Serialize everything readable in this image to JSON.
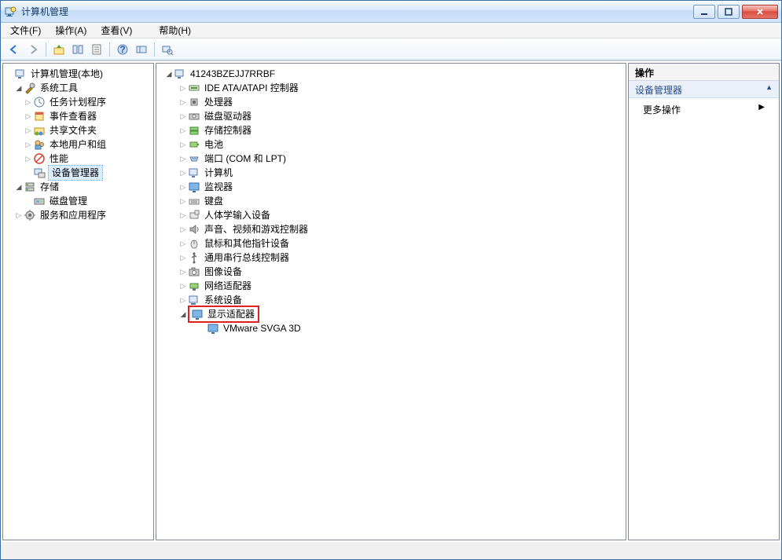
{
  "title": "计算机管理",
  "menu": {
    "file": "文件(F)",
    "action": "操作(A)",
    "view": "查看(V)",
    "help": "帮助(H)"
  },
  "leftTree": {
    "root": "计算机管理(本地)",
    "systemTools": "系统工具",
    "taskScheduler": "任务计划程序",
    "eventViewer": "事件查看器",
    "sharedFolders": "共享文件夹",
    "localUsersGroups": "本地用户和组",
    "performance": "性能",
    "deviceManager": "设备管理器",
    "storage": "存储",
    "diskManagement": "磁盘管理",
    "services": "服务和应用程序"
  },
  "deviceTree": {
    "computer": "41243BZEJJ7RRBF",
    "ide": "IDE ATA/ATAPI 控制器",
    "cpu": "处理器",
    "diskDrive": "磁盘驱动器",
    "storageCtrl": "存储控制器",
    "battery": "电池",
    "ports": "端口 (COM 和 LPT)",
    "computers": "计算机",
    "monitors": "监视器",
    "keyboards": "键盘",
    "hid": "人体学输入设备",
    "sound": "声音、视频和游戏控制器",
    "mouse": "鼠标和其他指针设备",
    "usb": "通用串行总线控制器",
    "imaging": "图像设备",
    "network": "网络适配器",
    "systemDevices": "系统设备",
    "display": "显示适配器",
    "vmware": "VMware SVGA 3D"
  },
  "right": {
    "header": "操作",
    "section": "设备管理器",
    "more": "更多操作"
  }
}
